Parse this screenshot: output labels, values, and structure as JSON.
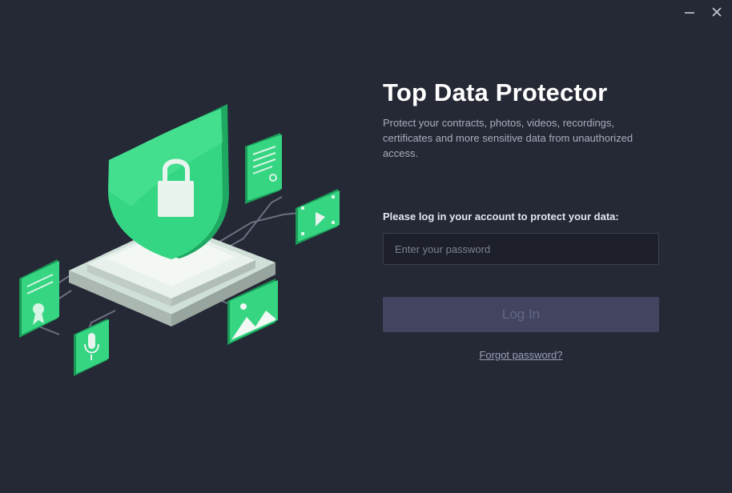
{
  "window": {
    "minimize_icon": "minimize-icon",
    "close_icon": "close-icon"
  },
  "illustration": {
    "icons": [
      "shield-lock-icon",
      "document-icon",
      "video-icon",
      "certificate-icon",
      "microphone-icon",
      "image-icon"
    ]
  },
  "main": {
    "title": "Top Data Protector",
    "description": "Protect your contracts, photos, videos, recordings, certificates and more sensitive data from unauthorized access.",
    "login_prompt": "Please log in your account to protect your data:",
    "password_placeholder": "Enter your password",
    "password_value": "",
    "login_label": "Log In",
    "forgot_label": "Forgot password?"
  },
  "colors": {
    "background": "#252835",
    "accent_green": "#2ed178",
    "input_bg": "#1d1f2a",
    "button_disabled": "#434560"
  }
}
